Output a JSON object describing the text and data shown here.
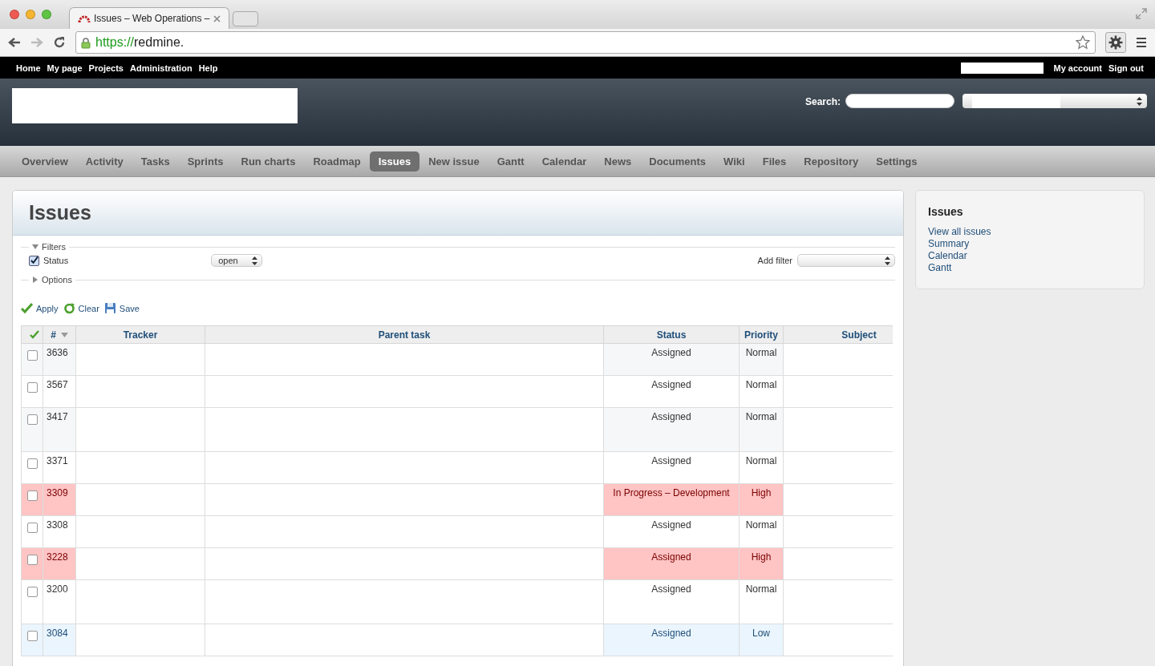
{
  "browser": {
    "tab_title": "Issues – Web Operations –",
    "url_scheme": "https://",
    "url_rest": "redmine."
  },
  "top_menu": {
    "left": [
      "Home",
      "My page",
      "Projects",
      "Administration",
      "Help"
    ],
    "right": [
      "My account",
      "Sign out"
    ]
  },
  "header": {
    "search_label": "Search:"
  },
  "main_menu": [
    {
      "label": "Overview",
      "selected": false
    },
    {
      "label": "Activity",
      "selected": false
    },
    {
      "label": "Tasks",
      "selected": false
    },
    {
      "label": "Sprints",
      "selected": false
    },
    {
      "label": "Run charts",
      "selected": false
    },
    {
      "label": "Roadmap",
      "selected": false
    },
    {
      "label": "Issues",
      "selected": true
    },
    {
      "label": "New issue",
      "selected": false
    },
    {
      "label": "Gantt",
      "selected": false
    },
    {
      "label": "Calendar",
      "selected": false
    },
    {
      "label": "News",
      "selected": false
    },
    {
      "label": "Documents",
      "selected": false
    },
    {
      "label": "Wiki",
      "selected": false
    },
    {
      "label": "Files",
      "selected": false
    },
    {
      "label": "Repository",
      "selected": false
    },
    {
      "label": "Settings",
      "selected": false
    }
  ],
  "content": {
    "title": "Issues",
    "filters": {
      "legend": "Filters",
      "expanded": true,
      "items": [
        {
          "label": "Status",
          "checked": true,
          "value": "open"
        }
      ],
      "add_filter_label": "Add filter"
    },
    "options": {
      "legend": "Options",
      "expanded": false
    },
    "actions": [
      "Apply",
      "Clear",
      "Save"
    ],
    "table": {
      "columns": [
        "#",
        "Tracker",
        "Parent task",
        "Status",
        "Priority",
        "Subject"
      ],
      "rows": [
        {
          "id": "3636",
          "status": "Assigned",
          "priority": "Normal",
          "kind": "normal",
          "tall": false
        },
        {
          "id": "3567",
          "status": "Assigned",
          "priority": "Normal",
          "kind": "normal",
          "tall": false
        },
        {
          "id": "3417",
          "status": "Assigned",
          "priority": "Normal",
          "kind": "normal",
          "tall": true
        },
        {
          "id": "3371",
          "status": "Assigned",
          "priority": "Normal",
          "kind": "normal",
          "tall": false
        },
        {
          "id": "3309",
          "status": "In Progress – Development",
          "priority": "High",
          "kind": "high",
          "tall": false
        },
        {
          "id": "3308",
          "status": "Assigned",
          "priority": "Normal",
          "kind": "normal",
          "tall": false
        },
        {
          "id": "3228",
          "status": "Assigned",
          "priority": "High",
          "kind": "high",
          "tall": false
        },
        {
          "id": "3200",
          "status": "Assigned",
          "priority": "Normal",
          "kind": "normal",
          "tall": true
        },
        {
          "id": "3084",
          "status": "Assigned",
          "priority": "Low",
          "kind": "low",
          "tall": false
        }
      ]
    }
  },
  "sidebar": {
    "title": "Issues",
    "links": [
      "View all issues",
      "Summary",
      "Calendar",
      "Gantt"
    ]
  }
}
